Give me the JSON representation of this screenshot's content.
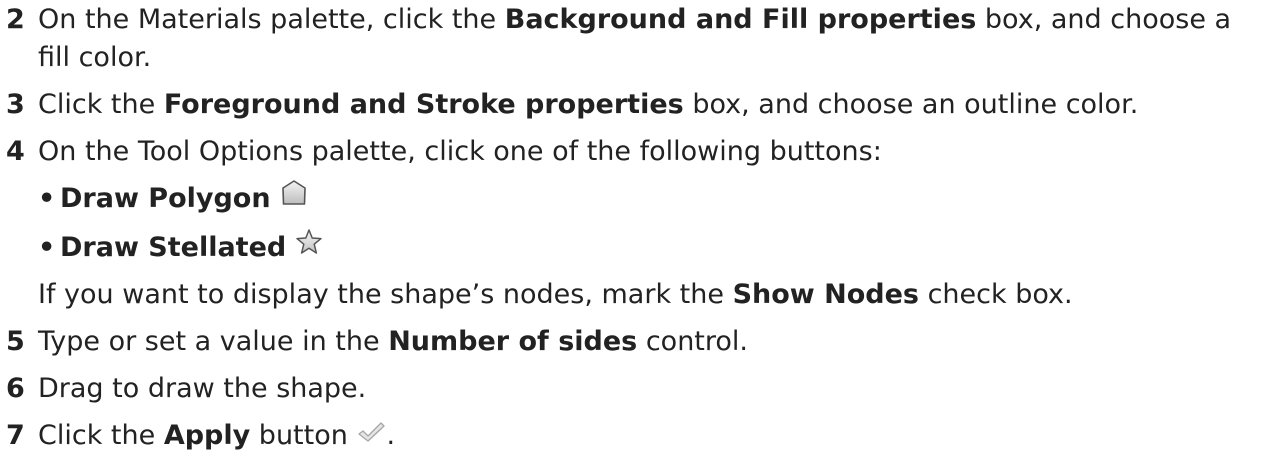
{
  "steps": [
    {
      "num": "2",
      "pre": "On the Materials palette, click the ",
      "bold": "Background and Fill properties",
      "post": " box, and choose a fill color."
    },
    {
      "num": "3",
      "pre": "Click the ",
      "bold": "Foreground and Stroke properties",
      "post": " box, and choose an outline color."
    },
    {
      "num": "4",
      "text": "On the Tool Options palette, click one of the following buttons:",
      "options": [
        {
          "bullet": "•",
          "label": "Draw Polygon",
          "icon": "polygon-icon"
        },
        {
          "bullet": "•",
          "label": "Draw Stellated",
          "icon": "star-icon"
        }
      ],
      "note_pre": "If you want to display the shape’s nodes, mark the ",
      "note_bold": "Show Nodes",
      "note_post": " check box."
    },
    {
      "num": "5",
      "pre": "Type or set a value in the ",
      "bold": "Number of sides",
      "post": " control."
    },
    {
      "num": "6",
      "text": "Drag to draw the shape."
    },
    {
      "num": "7",
      "pre": "Click the ",
      "bold": "Apply",
      "post": " button ",
      "end": ".",
      "icon": "checkmark-icon"
    }
  ]
}
